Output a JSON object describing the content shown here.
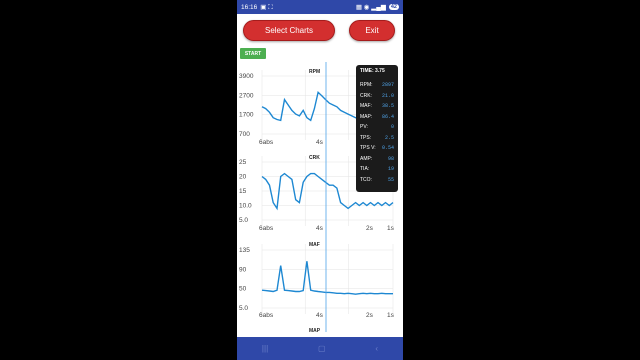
{
  "status": {
    "time": "16:16",
    "battery": "42"
  },
  "buttons": {
    "select_charts": "Select Charts",
    "exit": "Exit",
    "start": "START"
  },
  "charts": [
    {
      "title": "RPM",
      "y_ticks": [
        "3900",
        "2700",
        "1700",
        "700"
      ],
      "x_ticks": [
        "6abs",
        "4s",
        ""
      ]
    },
    {
      "title": "CRK",
      "y_ticks": [
        "25",
        "20",
        "15",
        "10.0",
        "5.0"
      ],
      "x_ticks": [
        "6abs",
        "4s",
        "2s",
        "1s"
      ]
    },
    {
      "title": "MAF",
      "y_ticks": [
        "135",
        "90",
        "50",
        "5.0"
      ],
      "x_ticks": [
        "6abs",
        "4s",
        "2s",
        "1s"
      ]
    },
    {
      "title": "MAP"
    }
  ],
  "tooltip": {
    "time_label": "TIME: 3.75",
    "rows": [
      {
        "label": "RPM:",
        "value": "2897"
      },
      {
        "label": "CRK:",
        "value": "21.0"
      },
      {
        "label": "MAF:",
        "value": "38.5"
      },
      {
        "label": "MAP:",
        "value": "86.4"
      },
      {
        "label": "PV:",
        "value": "0"
      },
      {
        "label": "TPS:",
        "value": "2.5"
      },
      {
        "label": "TPS V:",
        "value": "0.54"
      },
      {
        "label": "AMP:",
        "value": "98"
      },
      {
        "label": "TIA:",
        "value": "19"
      },
      {
        "label": "TCO:",
        "value": "55"
      }
    ]
  },
  "accent": "#1E88D2",
  "cursor_color": "#4FA3E8",
  "chart_data": [
    {
      "type": "line",
      "title": "RPM",
      "ylim": [
        700,
        3900
      ],
      "x": [
        0,
        1,
        2,
        3,
        4,
        5,
        6,
        7,
        8,
        9,
        10,
        11,
        12,
        13,
        14,
        15,
        16,
        17,
        18,
        19,
        20,
        21,
        22,
        23,
        24,
        25,
        26,
        27,
        28,
        29,
        30,
        31,
        32,
        33,
        34,
        35
      ],
      "y": [
        2200,
        2100,
        1900,
        1600,
        1500,
        1450,
        2600,
        2300,
        2000,
        1800,
        1700,
        2000,
        1600,
        1450,
        2100,
        3000,
        2800,
        2600,
        2400,
        2300,
        2200,
        2000,
        1900,
        1800,
        1700,
        1600,
        1550,
        1500,
        1500,
        1450,
        1450,
        1400,
        1400,
        1380,
        1400,
        1450
      ]
    },
    {
      "type": "line",
      "title": "CRK",
      "ylim": [
        5,
        25
      ],
      "x": [
        0,
        1,
        2,
        3,
        4,
        5,
        6,
        7,
        8,
        9,
        10,
        11,
        12,
        13,
        14,
        15,
        16,
        17,
        18,
        19,
        20,
        21,
        22,
        23,
        24,
        25,
        26,
        27,
        28,
        29,
        30,
        31,
        32,
        33,
        34,
        35
      ],
      "y": [
        20,
        19,
        17,
        11,
        9,
        20,
        21,
        20,
        19,
        12,
        11,
        18,
        20,
        21,
        21,
        20,
        19,
        18,
        17,
        17,
        16,
        11,
        10,
        9,
        10,
        11,
        10,
        11,
        10,
        11,
        10,
        11,
        10,
        11,
        10,
        11
      ]
    },
    {
      "type": "line",
      "title": "MAF",
      "ylim": [
        5,
        135
      ],
      "x": [
        0,
        1,
        2,
        3,
        4,
        5,
        6,
        7,
        8,
        9,
        10,
        11,
        12,
        13,
        14,
        15,
        16,
        17,
        18,
        19,
        20,
        21,
        22,
        23,
        24,
        25,
        26,
        27,
        28,
        29,
        30,
        31,
        32,
        33,
        34,
        35
      ],
      "y": [
        45,
        44,
        43,
        42,
        45,
        100,
        45,
        44,
        43,
        42,
        42,
        44,
        110,
        45,
        43,
        42,
        41,
        40,
        40,
        39,
        38,
        38,
        37,
        38,
        37,
        36,
        37,
        38,
        37,
        38,
        37,
        37,
        38,
        37,
        37,
        37
      ]
    }
  ]
}
